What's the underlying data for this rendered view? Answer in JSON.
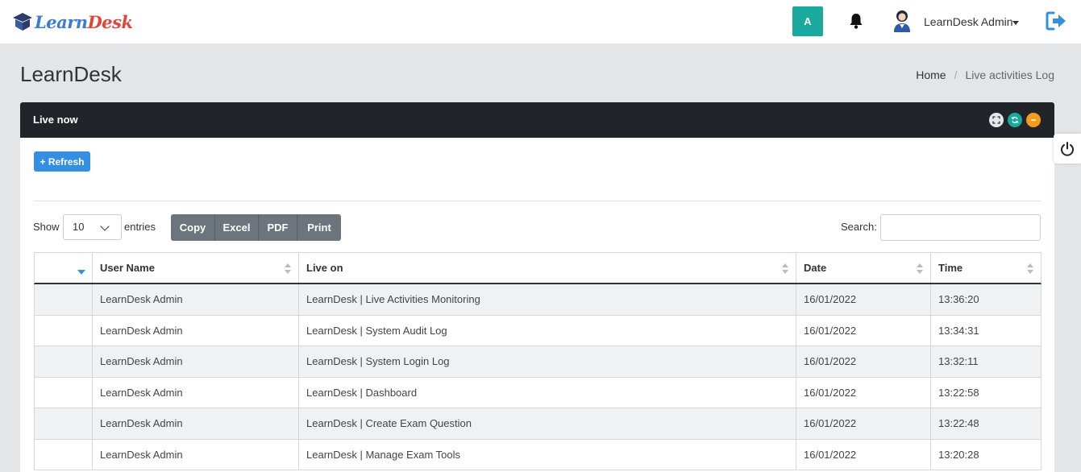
{
  "brand": {
    "part1": "Learn",
    "part2": "Desk"
  },
  "header": {
    "avatar_initial": "A",
    "user_name": "LearnDesk Admin",
    "icons": [
      "bell-icon",
      "user-photo",
      "logout-icon"
    ]
  },
  "page": {
    "title": "LearnDesk",
    "breadcrumb": {
      "home": "Home",
      "separator": "/",
      "current": "Live activities Log"
    }
  },
  "panel": {
    "title": "Live now",
    "refresh_label": "+ Refresh",
    "controls": [
      "expand-icon",
      "reload-icon",
      "collapse-icon"
    ]
  },
  "table_controls": {
    "show_label": "Show",
    "page_length": "10",
    "entries_label": "entries",
    "export_buttons": [
      "Copy",
      "Excel",
      "PDF",
      "Print"
    ],
    "search_label": "Search:"
  },
  "table": {
    "columns": [
      "",
      "User Name",
      "Live on",
      "Date",
      "Time"
    ],
    "rows": [
      [
        "",
        "LearnDesk Admin",
        "LearnDesk | Live Activities Monitoring",
        "16/01/2022",
        "13:36:20"
      ],
      [
        "",
        "LearnDesk Admin",
        "LearnDesk | System Audit Log",
        "16/01/2022",
        "13:34:31"
      ],
      [
        "",
        "LearnDesk Admin",
        "LearnDesk | System Login Log",
        "16/01/2022",
        "13:32:11"
      ],
      [
        "",
        "LearnDesk Admin",
        "LearnDesk | Dashboard",
        "16/01/2022",
        "13:22:58"
      ],
      [
        "",
        "LearnDesk Admin",
        "LearnDesk | Create Exam Question",
        "16/01/2022",
        "13:22:48"
      ],
      [
        "",
        "LearnDesk Admin",
        "LearnDesk | Manage Exam Tools",
        "16/01/2022",
        "13:20:28"
      ]
    ]
  },
  "colors": {
    "teal": "#1aa99f",
    "blue": "#348fe2",
    "orange": "#f59c1a",
    "dark": "#212529"
  }
}
